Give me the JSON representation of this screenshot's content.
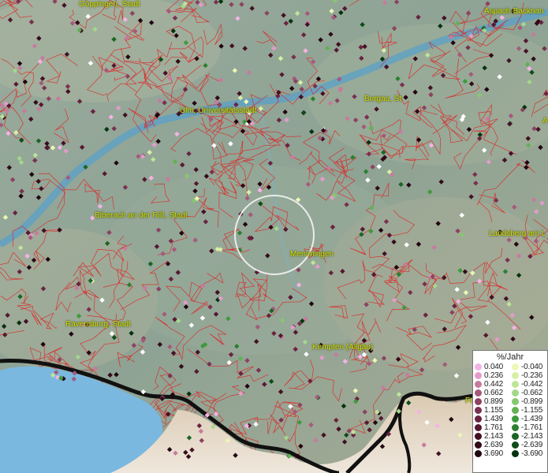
{
  "map": {
    "cities": [
      {
        "name": "Göppingen, Stadt"
      },
      {
        "name": "Aspach-Backnan"
      },
      {
        "name": "Ulm, Universitätsstadt"
      },
      {
        "name": "Burgau, St"
      },
      {
        "name": "Biberach an der Riß, Stadt"
      },
      {
        "name": "Memmingen"
      },
      {
        "name": "Landsberg am L"
      },
      {
        "name": "Ravensburg, Stadt"
      },
      {
        "name": "Kempten (Allgäu)"
      },
      {
        "name": "Fü"
      },
      {
        "name": "A"
      }
    ]
  },
  "legend": {
    "title": "%/Jahr",
    "rows": [
      {
        "pos": "0.040",
        "neg": "-0.040",
        "pos_color": "#f3b3e6",
        "neg_color": "#eef7b5"
      },
      {
        "pos": "0.236",
        "neg": "-0.236",
        "pos_color": "#e39ccb",
        "neg_color": "#d8efa6"
      },
      {
        "pos": "0.442",
        "neg": "-0.442",
        "pos_color": "#c77a9f",
        "neg_color": "#bfe49a"
      },
      {
        "pos": "0.662",
        "neg": "-0.662",
        "pos_color": "#a55a7c",
        "neg_color": "#a3d88b"
      },
      {
        "pos": "0.899",
        "neg": "-0.899",
        "pos_color": "#8c4260",
        "neg_color": "#86c870"
      },
      {
        "pos": "1.155",
        "neg": "-1.155",
        "pos_color": "#7a3050",
        "neg_color": "#62b154"
      },
      {
        "pos": "1.439",
        "neg": "-1.439",
        "pos_color": "#6a2240",
        "neg_color": "#3f9a3c"
      },
      {
        "pos": "1.761",
        "neg": "-1.761",
        "pos_color": "#561831",
        "neg_color": "#2a8030"
      },
      {
        "pos": "2.143",
        "neg": "-2.143",
        "pos_color": "#441024",
        "neg_color": "#1a6624"
      },
      {
        "pos": "2.639",
        "neg": "-2.639",
        "pos_color": "#320a18",
        "neg_color": "#0e4c18"
      },
      {
        "pos": "3.690",
        "neg": "-3.690",
        "pos_color": "#220410",
        "neg_color": "#06330e"
      }
    ]
  },
  "colors": {
    "city_label": "#d8e000",
    "boundary": "#e02020",
    "river": "#5aa0c8",
    "lake": "#7ab8e0",
    "border": "#111111"
  }
}
